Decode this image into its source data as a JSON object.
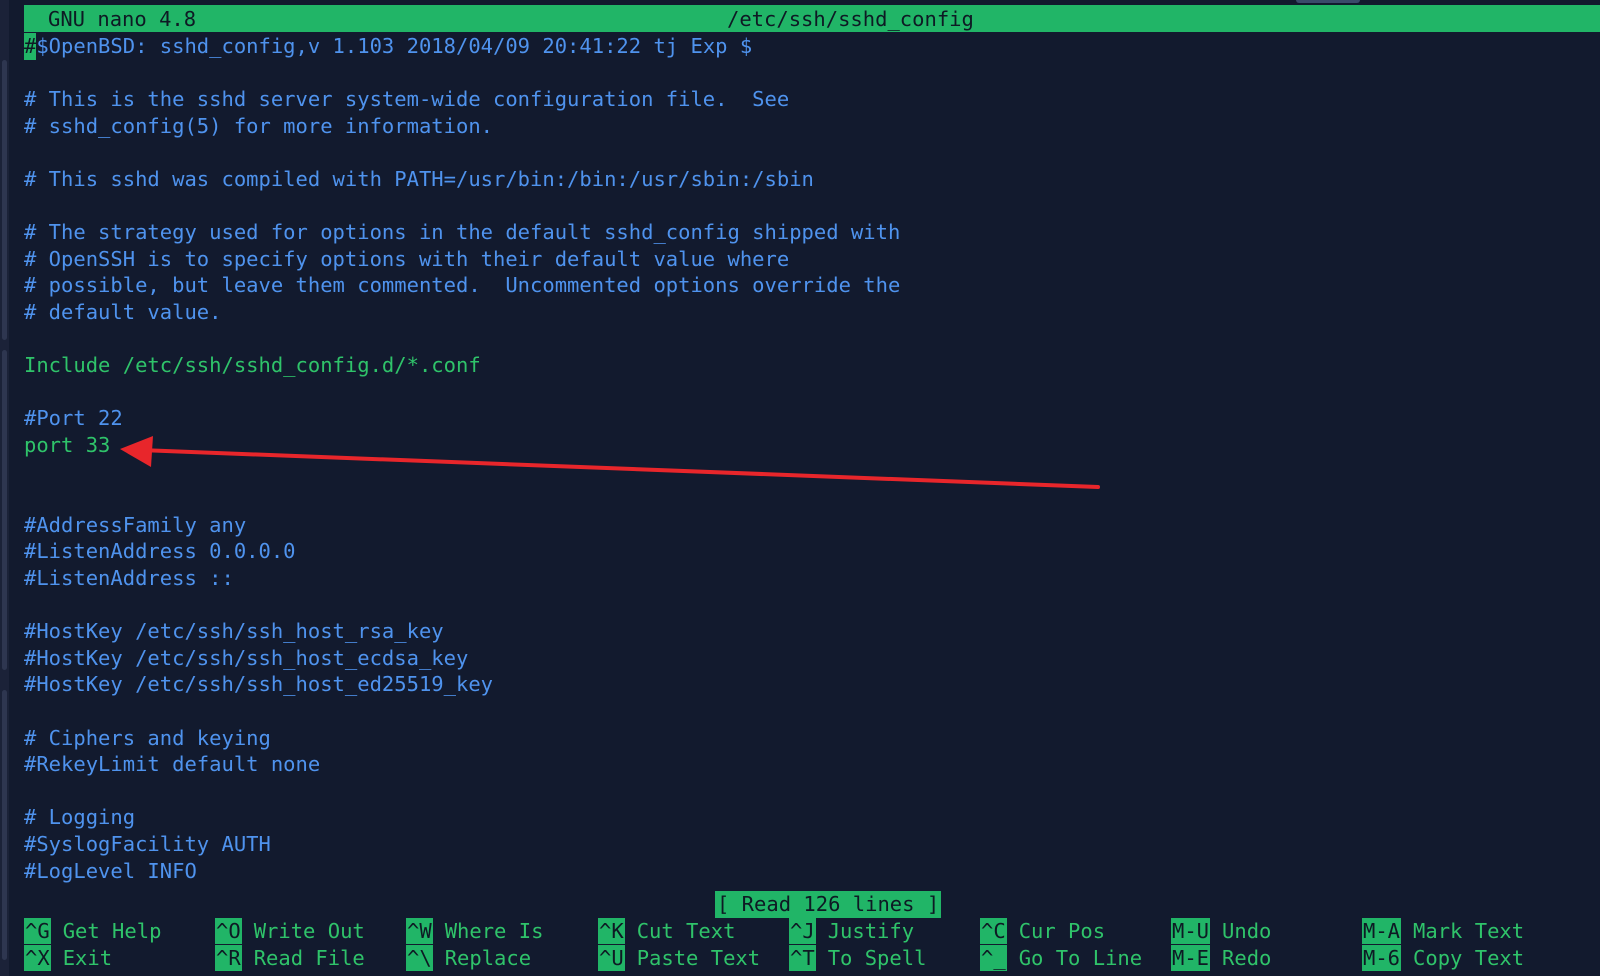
{
  "titlebar": {
    "app": "GNU nano 4.8",
    "filename": "/etc/ssh/sshd_config"
  },
  "cursor_char": "#",
  "lines": [
    {
      "text": "$OpenBSD: sshd_config,v 1.103 2018/04/09 20:41:22 tj Exp $",
      "kind": "comment"
    },
    {
      "text": "",
      "kind": "comment"
    },
    {
      "text": "# This is the sshd server system-wide configuration file.  See",
      "kind": "comment"
    },
    {
      "text": "# sshd_config(5) for more information.",
      "kind": "comment"
    },
    {
      "text": "",
      "kind": "comment"
    },
    {
      "text": "# This sshd was compiled with PATH=/usr/bin:/bin:/usr/sbin:/sbin",
      "kind": "comment"
    },
    {
      "text": "",
      "kind": "comment"
    },
    {
      "text": "# The strategy used for options in the default sshd_config shipped with",
      "kind": "comment"
    },
    {
      "text": "# OpenSSH is to specify options with their default value where",
      "kind": "comment"
    },
    {
      "text": "# possible, but leave them commented.  Uncommented options override the",
      "kind": "comment"
    },
    {
      "text": "# default value.",
      "kind": "comment"
    },
    {
      "text": "",
      "kind": "comment"
    },
    {
      "text": "Include /etc/ssh/sshd_config.d/*.conf",
      "kind": "code"
    },
    {
      "text": "",
      "kind": "comment"
    },
    {
      "text": "#Port 22",
      "kind": "comment"
    },
    {
      "text": "port 33",
      "kind": "code"
    },
    {
      "text": "",
      "kind": "comment"
    },
    {
      "text": "",
      "kind": "comment"
    },
    {
      "text": "#AddressFamily any",
      "kind": "comment"
    },
    {
      "text": "#ListenAddress 0.0.0.0",
      "kind": "comment"
    },
    {
      "text": "#ListenAddress ::",
      "kind": "comment"
    },
    {
      "text": "",
      "kind": "comment"
    },
    {
      "text": "#HostKey /etc/ssh/ssh_host_rsa_key",
      "kind": "comment"
    },
    {
      "text": "#HostKey /etc/ssh/ssh_host_ecdsa_key",
      "kind": "comment"
    },
    {
      "text": "#HostKey /etc/ssh/ssh_host_ed25519_key",
      "kind": "comment"
    },
    {
      "text": "",
      "kind": "comment"
    },
    {
      "text": "# Ciphers and keying",
      "kind": "comment"
    },
    {
      "text": "#RekeyLimit default none",
      "kind": "comment"
    },
    {
      "text": "",
      "kind": "comment"
    },
    {
      "text": "# Logging",
      "kind": "comment"
    },
    {
      "text": "#SyslogFacility AUTH",
      "kind": "comment"
    },
    {
      "text": "#LogLevel INFO",
      "kind": "comment"
    }
  ],
  "status": "[ Read 126 lines ]",
  "shortcuts": [
    [
      {
        "key": "^G",
        "label": "Get Help"
      },
      {
        "key": "^X",
        "label": "Exit"
      }
    ],
    [
      {
        "key": "^O",
        "label": "Write Out"
      },
      {
        "key": "^R",
        "label": "Read File"
      }
    ],
    [
      {
        "key": "^W",
        "label": "Where Is"
      },
      {
        "key": "^\\",
        "label": "Replace"
      }
    ],
    [
      {
        "key": "^K",
        "label": "Cut Text"
      },
      {
        "key": "^U",
        "label": "Paste Text"
      }
    ],
    [
      {
        "key": "^J",
        "label": "Justify"
      },
      {
        "key": "^T",
        "label": "To Spell"
      }
    ],
    [
      {
        "key": "^C",
        "label": "Cur Pos"
      },
      {
        "key": "^_",
        "label": "Go To Line"
      }
    ],
    [
      {
        "key": "M-U",
        "label": "Undo"
      },
      {
        "key": "M-E",
        "label": "Redo"
      }
    ],
    [
      {
        "key": "M-A",
        "label": "Mark Text"
      },
      {
        "key": "M-6",
        "label": "Copy Text"
      }
    ]
  ],
  "colors": {
    "background": "#121a2e",
    "bar": "#21b567",
    "comment": "#4f93ee",
    "code": "#2fc36a",
    "annotation_arrow": "#e8262b"
  }
}
